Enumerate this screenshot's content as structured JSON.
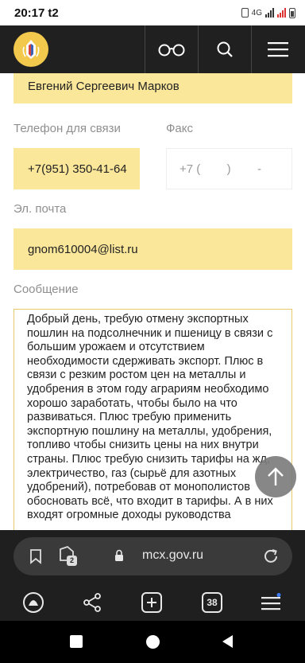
{
  "status_bar": {
    "time": "20:17",
    "carrier": "t2",
    "network": "4G",
    "icons": [
      "t2-carrier-icon",
      "vibrate-icon",
      "signal-icon",
      "signal-icon",
      "battery-icon"
    ]
  },
  "header": {
    "icons": [
      "emblem-logo-icon",
      "glasses-icon",
      "search-icon",
      "hamburger-menu-icon"
    ]
  },
  "form": {
    "name_value": "Евгений Сергеевич Марков",
    "phone_label": "Телефон для связи",
    "fax_label": "Факс",
    "phone_value": "+7(951) 350-41-64",
    "fax_placeholder": "+7 (        )        -",
    "email_label": "Эл. почта",
    "email_value": "gnom610004@list.ru",
    "message_label": "Сообщение",
    "message_text": "Добрый день, требую отмену экспортных пошлин на подсолнечник и пшеницу в связи с большим урожаем и отсутствием необходимости сдерживать экспорт. Плюс в связи с резким ростом цен на металлы и удобрения в этом году аграриям необходимо хорошо заработать, чтобы было на что развиваться. Плюс требую применить экспортную пошлину на металлы, удобрения, топливо чтобы снизить цены на них внутри страны. Плюс требую снизить тарифы на жд, электричество, газ (сырьё для азотных удобрений), потребовав от монополистов обосновать всё, что входит в тарифы. А в них входят огромные доходы руководства"
  },
  "browser": {
    "url": "mcx.gov.ru",
    "tab_count_badge": "2",
    "tabs_count": "38"
  },
  "colors": {
    "header_bg": "#202020",
    "field_bg": "#fbe79a",
    "accent": "#f2c94c",
    "browser_bg": "#1f1f1f"
  }
}
